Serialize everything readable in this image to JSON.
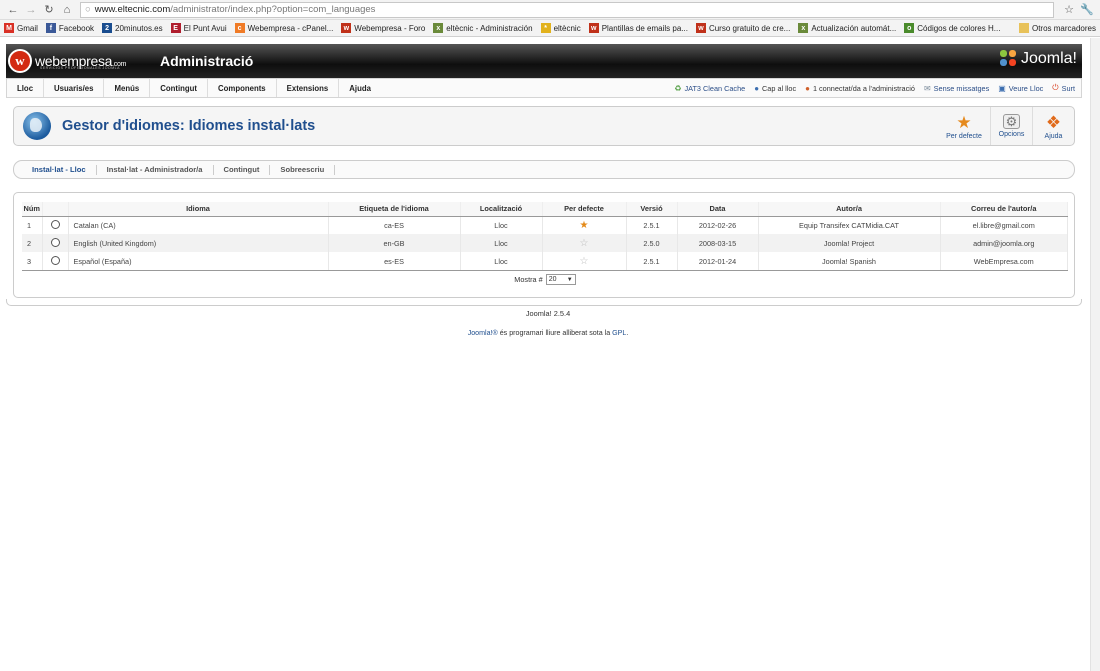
{
  "browser": {
    "url_host": "www.eltecnic.com",
    "url_path": "/administrator/index.php?option=com_languages",
    "bookmarks": [
      {
        "label": "Gmail",
        "icon": "gmail-icon",
        "color": "#d93025",
        "glyph": "M"
      },
      {
        "label": "Facebook",
        "icon": "facebook-icon",
        "color": "#3b5998",
        "glyph": "f"
      },
      {
        "label": "20minutos.es",
        "icon": "20minutos-icon",
        "color": "#1a4d8f",
        "glyph": "2"
      },
      {
        "label": "El Punt Avui",
        "icon": "elpunt-icon",
        "color": "#b01e2e",
        "glyph": "E"
      },
      {
        "label": "Webempresa - cPanel...",
        "icon": "cpanel-icon",
        "color": "#f07b26",
        "glyph": "c"
      },
      {
        "label": "Webempresa - Foro",
        "icon": "webempresa-icon",
        "color": "#c0311a",
        "glyph": "w"
      },
      {
        "label": "eltècnic - Administración",
        "icon": "tool-icon",
        "color": "#6a8a3a",
        "glyph": "x"
      },
      {
        "label": "eltècnic",
        "icon": "sun-icon",
        "color": "#e2b21d",
        "glyph": "*"
      },
      {
        "label": "Plantillas de emails pa...",
        "icon": "webempresa-icon",
        "color": "#c0311a",
        "glyph": "w"
      },
      {
        "label": "Curso gratuito de cre...",
        "icon": "webempresa-icon",
        "color": "#c0311a",
        "glyph": "w"
      },
      {
        "label": "Actualización automát...",
        "icon": "tool-icon",
        "color": "#6a8a3a",
        "glyph": "x"
      },
      {
        "label": "Códigos de colores H...",
        "icon": "chrome-icon",
        "color": "#4a8b2c",
        "glyph": "o"
      }
    ],
    "other_bookmarks": "Otros marcadores"
  },
  "header": {
    "brand": "webempresa",
    "brand_suffix": ".com",
    "brand_tagline": "SERVICIOS PROFESIONALES JOOMLA",
    "title": "Administració",
    "joomla_logo": "Joomla!"
  },
  "menu": {
    "items": [
      "Lloc",
      "Usuaris/es",
      "Menús",
      "Contingut",
      "Components",
      "Extensions",
      "Ajuda"
    ],
    "status": {
      "cache": "JAT3 Clean Cache",
      "site": "Cap al lloc",
      "connected": "1 connectat/da a l'administració",
      "messages": "Sense missatges",
      "view_site": "Veure Lloc",
      "logout": "Surt"
    }
  },
  "toolbar": {
    "heading": "Gestor d'idiomes: Idiomes instal·lats",
    "buttons": [
      {
        "label": "Per defecte",
        "icon": "star-icon"
      },
      {
        "label": "Opcions",
        "icon": "options-icon"
      },
      {
        "label": "Ajuda",
        "icon": "help-icon"
      }
    ]
  },
  "tabs": [
    "Instal·lat - Lloc",
    "Instal·lat - Administrador/a",
    "Contingut",
    "Sobreescriu"
  ],
  "table": {
    "columns": [
      "Núm",
      "",
      "Idioma",
      "Etiqueta de l'idioma",
      "Localització",
      "Per defecte",
      "Versió",
      "Data",
      "Autor/a",
      "Correu de l'autor/a"
    ],
    "rows": [
      {
        "num": "1",
        "language": "Catalan (CA)",
        "tag": "ca-ES",
        "location": "Lloc",
        "default": true,
        "version": "2.5.1",
        "date": "2012-02-26",
        "author": "Equip Transifex CATMidia.CAT",
        "email": "el.libre@gmail.com"
      },
      {
        "num": "2",
        "language": "English (United Kingdom)",
        "tag": "en-GB",
        "location": "Lloc",
        "default": false,
        "version": "2.5.0",
        "date": "2008-03-15",
        "author": "Joomla! Project",
        "email": "admin@joomla.org"
      },
      {
        "num": "3",
        "language": "Español (España)",
        "tag": "es-ES",
        "location": "Lloc",
        "default": false,
        "version": "2.5.1",
        "date": "2012-01-24",
        "author": "Joomla! Spanish",
        "email": "WebEmpresa.com"
      }
    ],
    "show_label": "Mostra #",
    "show_value": "20"
  },
  "footer": {
    "version": "Joomla! 2.5.4",
    "joomla_link": "Joomla!®",
    "license_text": " és programari lliure alliberat sota la ",
    "gpl_link": "GPL",
    "end": "."
  }
}
